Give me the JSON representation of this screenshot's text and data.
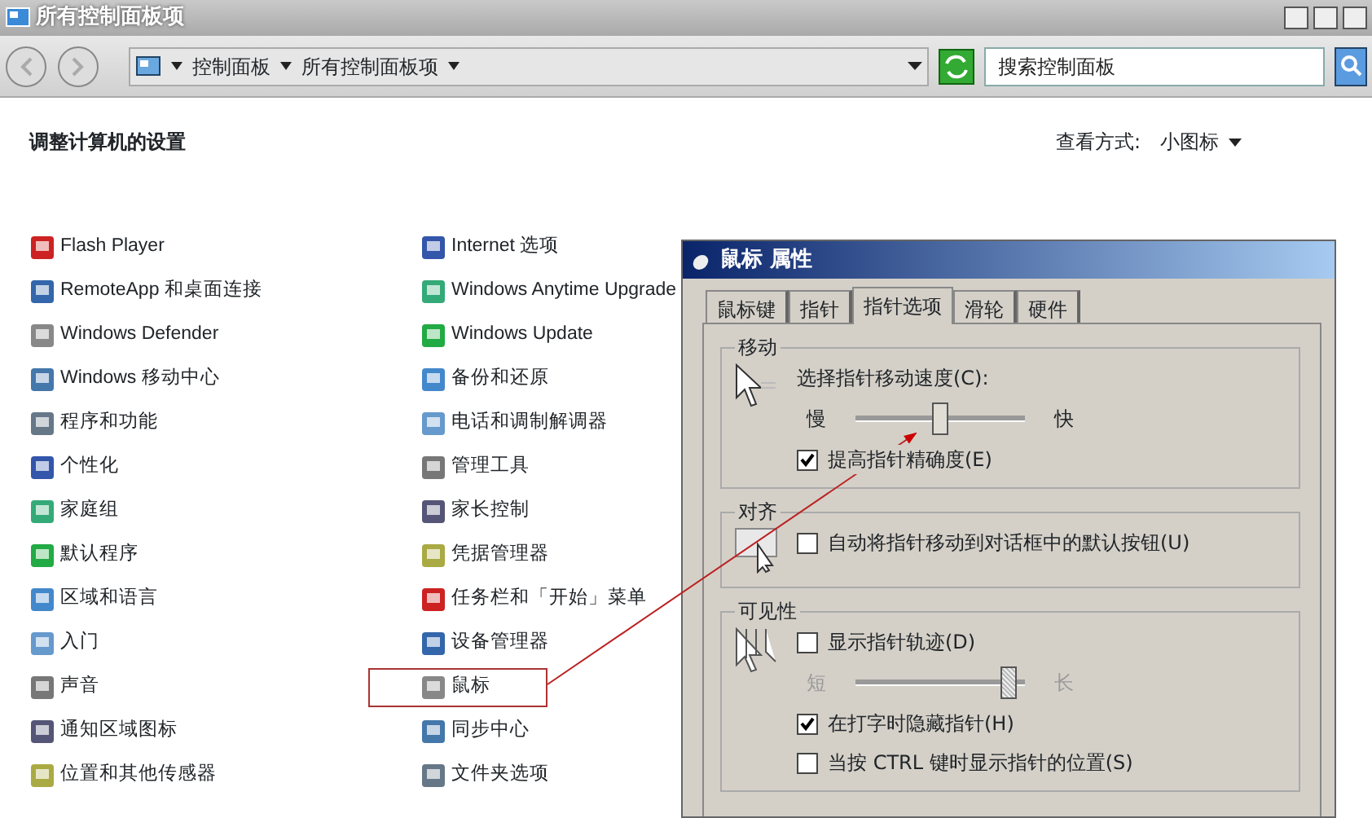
{
  "window": {
    "title": "所有控制面板项"
  },
  "address": {
    "crumbs": [
      "控制面板",
      "所有控制面板项"
    ]
  },
  "search": {
    "placeholder": "搜索控制面板"
  },
  "heading": "调整计算机的设置",
  "view_by": {
    "label": "查看方式:",
    "value": "小图标"
  },
  "columns": [
    [
      {
        "label": "Flash Player",
        "highlighted": false
      },
      {
        "label": "RemoteApp 和桌面连接",
        "highlighted": false
      },
      {
        "label": "Windows Defender",
        "highlighted": false
      },
      {
        "label": "Windows 移动中心",
        "highlighted": false
      },
      {
        "label": "程序和功能",
        "highlighted": false
      },
      {
        "label": "个性化",
        "highlighted": false
      },
      {
        "label": "家庭组",
        "highlighted": false
      },
      {
        "label": "默认程序",
        "highlighted": false
      },
      {
        "label": "区域和语言",
        "highlighted": false
      },
      {
        "label": "入门",
        "highlighted": false
      },
      {
        "label": "声音",
        "highlighted": false
      },
      {
        "label": "通知区域图标",
        "highlighted": false
      },
      {
        "label": "位置和其他传感器",
        "highlighted": false
      }
    ],
    [
      {
        "label": "Internet 选项",
        "highlighted": false
      },
      {
        "label": "Windows Anytime Upgrade",
        "highlighted": false
      },
      {
        "label": "Windows Update",
        "highlighted": false
      },
      {
        "label": "备份和还原",
        "highlighted": false
      },
      {
        "label": "电话和调制解调器",
        "highlighted": false
      },
      {
        "label": "管理工具",
        "highlighted": false
      },
      {
        "label": "家长控制",
        "highlighted": false
      },
      {
        "label": "凭据管理器",
        "highlighted": false
      },
      {
        "label": "任务栏和「开始」菜单",
        "highlighted": false
      },
      {
        "label": "设备管理器",
        "highlighted": false
      },
      {
        "label": "鼠标",
        "highlighted": true
      },
      {
        "label": "同步中心",
        "highlighted": false
      },
      {
        "label": "文件夹选项",
        "highlighted": false
      }
    ]
  ],
  "dialog": {
    "title": "鼠标 属性",
    "tabs": [
      {
        "label": "鼠标键",
        "selected": false
      },
      {
        "label": "指针",
        "selected": false
      },
      {
        "label": "指针选项",
        "selected": true
      },
      {
        "label": "滑轮",
        "selected": false
      },
      {
        "label": "硬件",
        "selected": false
      }
    ],
    "groups": [
      {
        "title": "移动",
        "rows": [
          {
            "kind": "label",
            "text": "选择指针移动速度(C):"
          },
          {
            "kind": "slider",
            "left": "慢",
            "right": "快",
            "level": 0.5,
            "disabled": false
          },
          {
            "kind": "checkbox",
            "label": "提高指针精确度(E)",
            "checked": true
          }
        ]
      },
      {
        "title": "对齐",
        "rows": [
          {
            "kind": "checkbox",
            "label": "自动将指针移动到对话框中的默认按钮(U)",
            "checked": false
          }
        ]
      },
      {
        "title": "可见性",
        "rows": [
          {
            "kind": "checkbox",
            "label": "显示指针轨迹(D)",
            "checked": false
          },
          {
            "kind": "slider",
            "left": "短",
            "right": "长",
            "level": 0.95,
            "disabled": true
          },
          {
            "kind": "checkbox",
            "label": "在打字时隐藏指针(H)",
            "checked": true
          },
          {
            "kind": "checkbox",
            "label": "当按 CTRL 键时显示指针的位置(S)",
            "checked": false
          }
        ]
      }
    ]
  }
}
